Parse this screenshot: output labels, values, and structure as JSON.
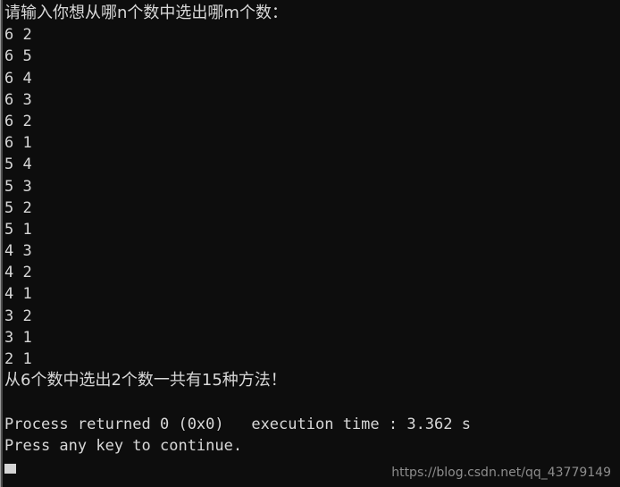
{
  "window": {
    "background_color": "#0d0d0d",
    "text_color": "#d8d8d8",
    "watermark_color": "#8d8d8d",
    "cursor_color": "#d4d4d4"
  },
  "console": {
    "prompt_line": "请输入你想从哪n个数中选出哪m个数：",
    "pairs": [
      "6 2",
      "6 5",
      "6 4",
      "6 3",
      "6 2",
      "6 1",
      "5 4",
      "5 3",
      "5 2",
      "5 1",
      "4 3",
      "4 2",
      "4 1",
      "3 2",
      "3 1",
      "2 1"
    ],
    "summary_line": "从6个数中选出2个数一共有15种方法！",
    "blank_line": "",
    "process_line": "Process returned 0 (0x0)   execution time : 3.362 s",
    "press_any_key_line": "Press any key to continue."
  },
  "watermark": {
    "text": "https://blog.csdn.net/qq_43779149"
  }
}
